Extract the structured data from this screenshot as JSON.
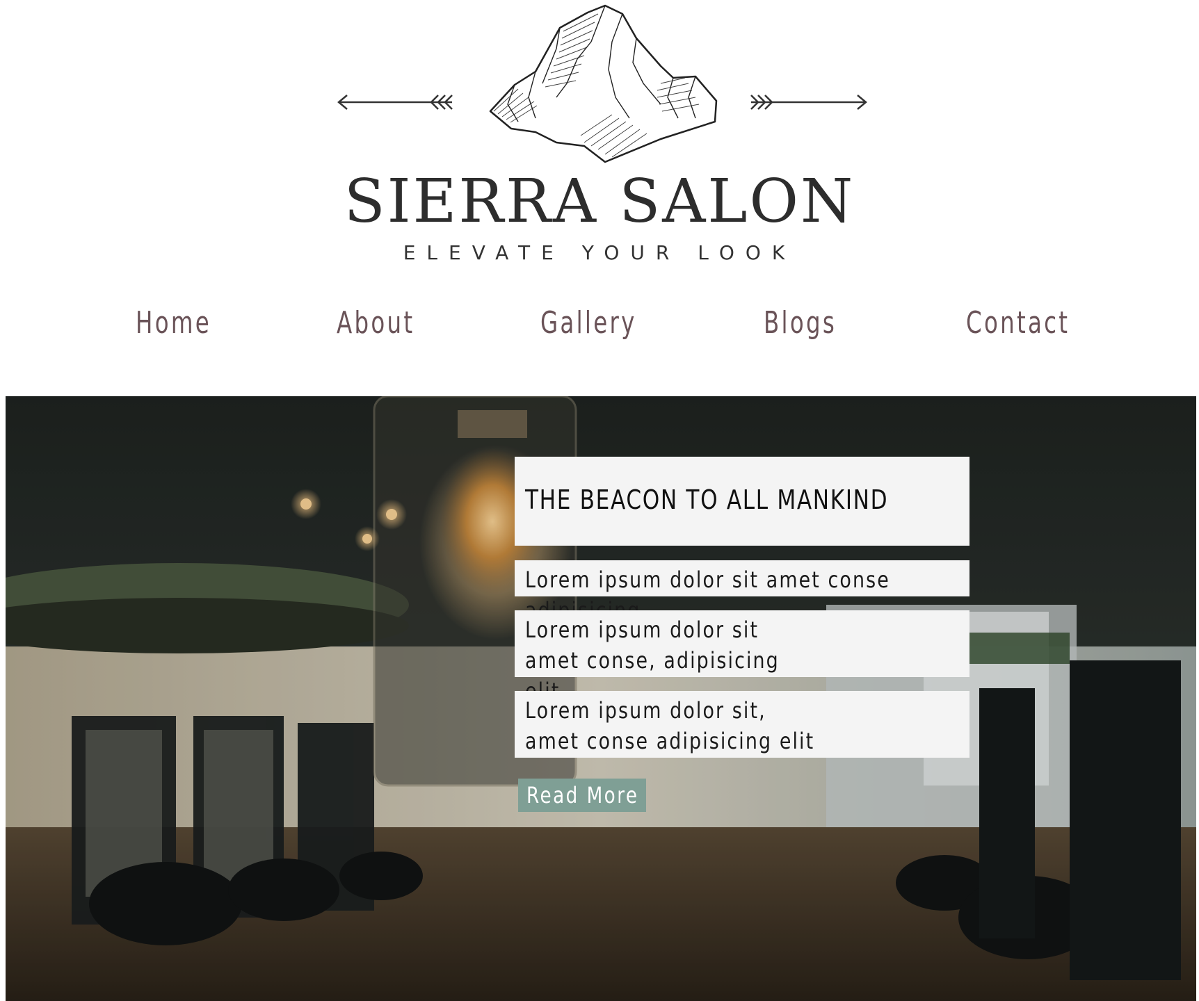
{
  "brand": {
    "name": "SIERRA SALON",
    "tagline": "ELEVATE YOUR LOOK",
    "logo_icon": "mountain-with-arrows-icon"
  },
  "nav": {
    "items": [
      {
        "label": "Home"
      },
      {
        "label": "About"
      },
      {
        "label": "Gallery"
      },
      {
        "label": "Blogs"
      },
      {
        "label": "Contact"
      }
    ]
  },
  "hero": {
    "background": "salon-interior-photo",
    "title": "THE BEACON TO ALL MANKIND",
    "lines": [
      "Lorem ipsum dolor sit amet conse adipisicing",
      "Lorem ipsum dolor sit amet conse, adipisicing elit",
      "Lorem ipsum dolor sit, amet conse adipisicing elit"
    ],
    "cta_label": "Read More"
  },
  "colors": {
    "nav_text": "#6a5358",
    "button_bg": "#7f9f95",
    "card_bg": "#f4f4f4",
    "logo_text": "#2d2d2d"
  }
}
